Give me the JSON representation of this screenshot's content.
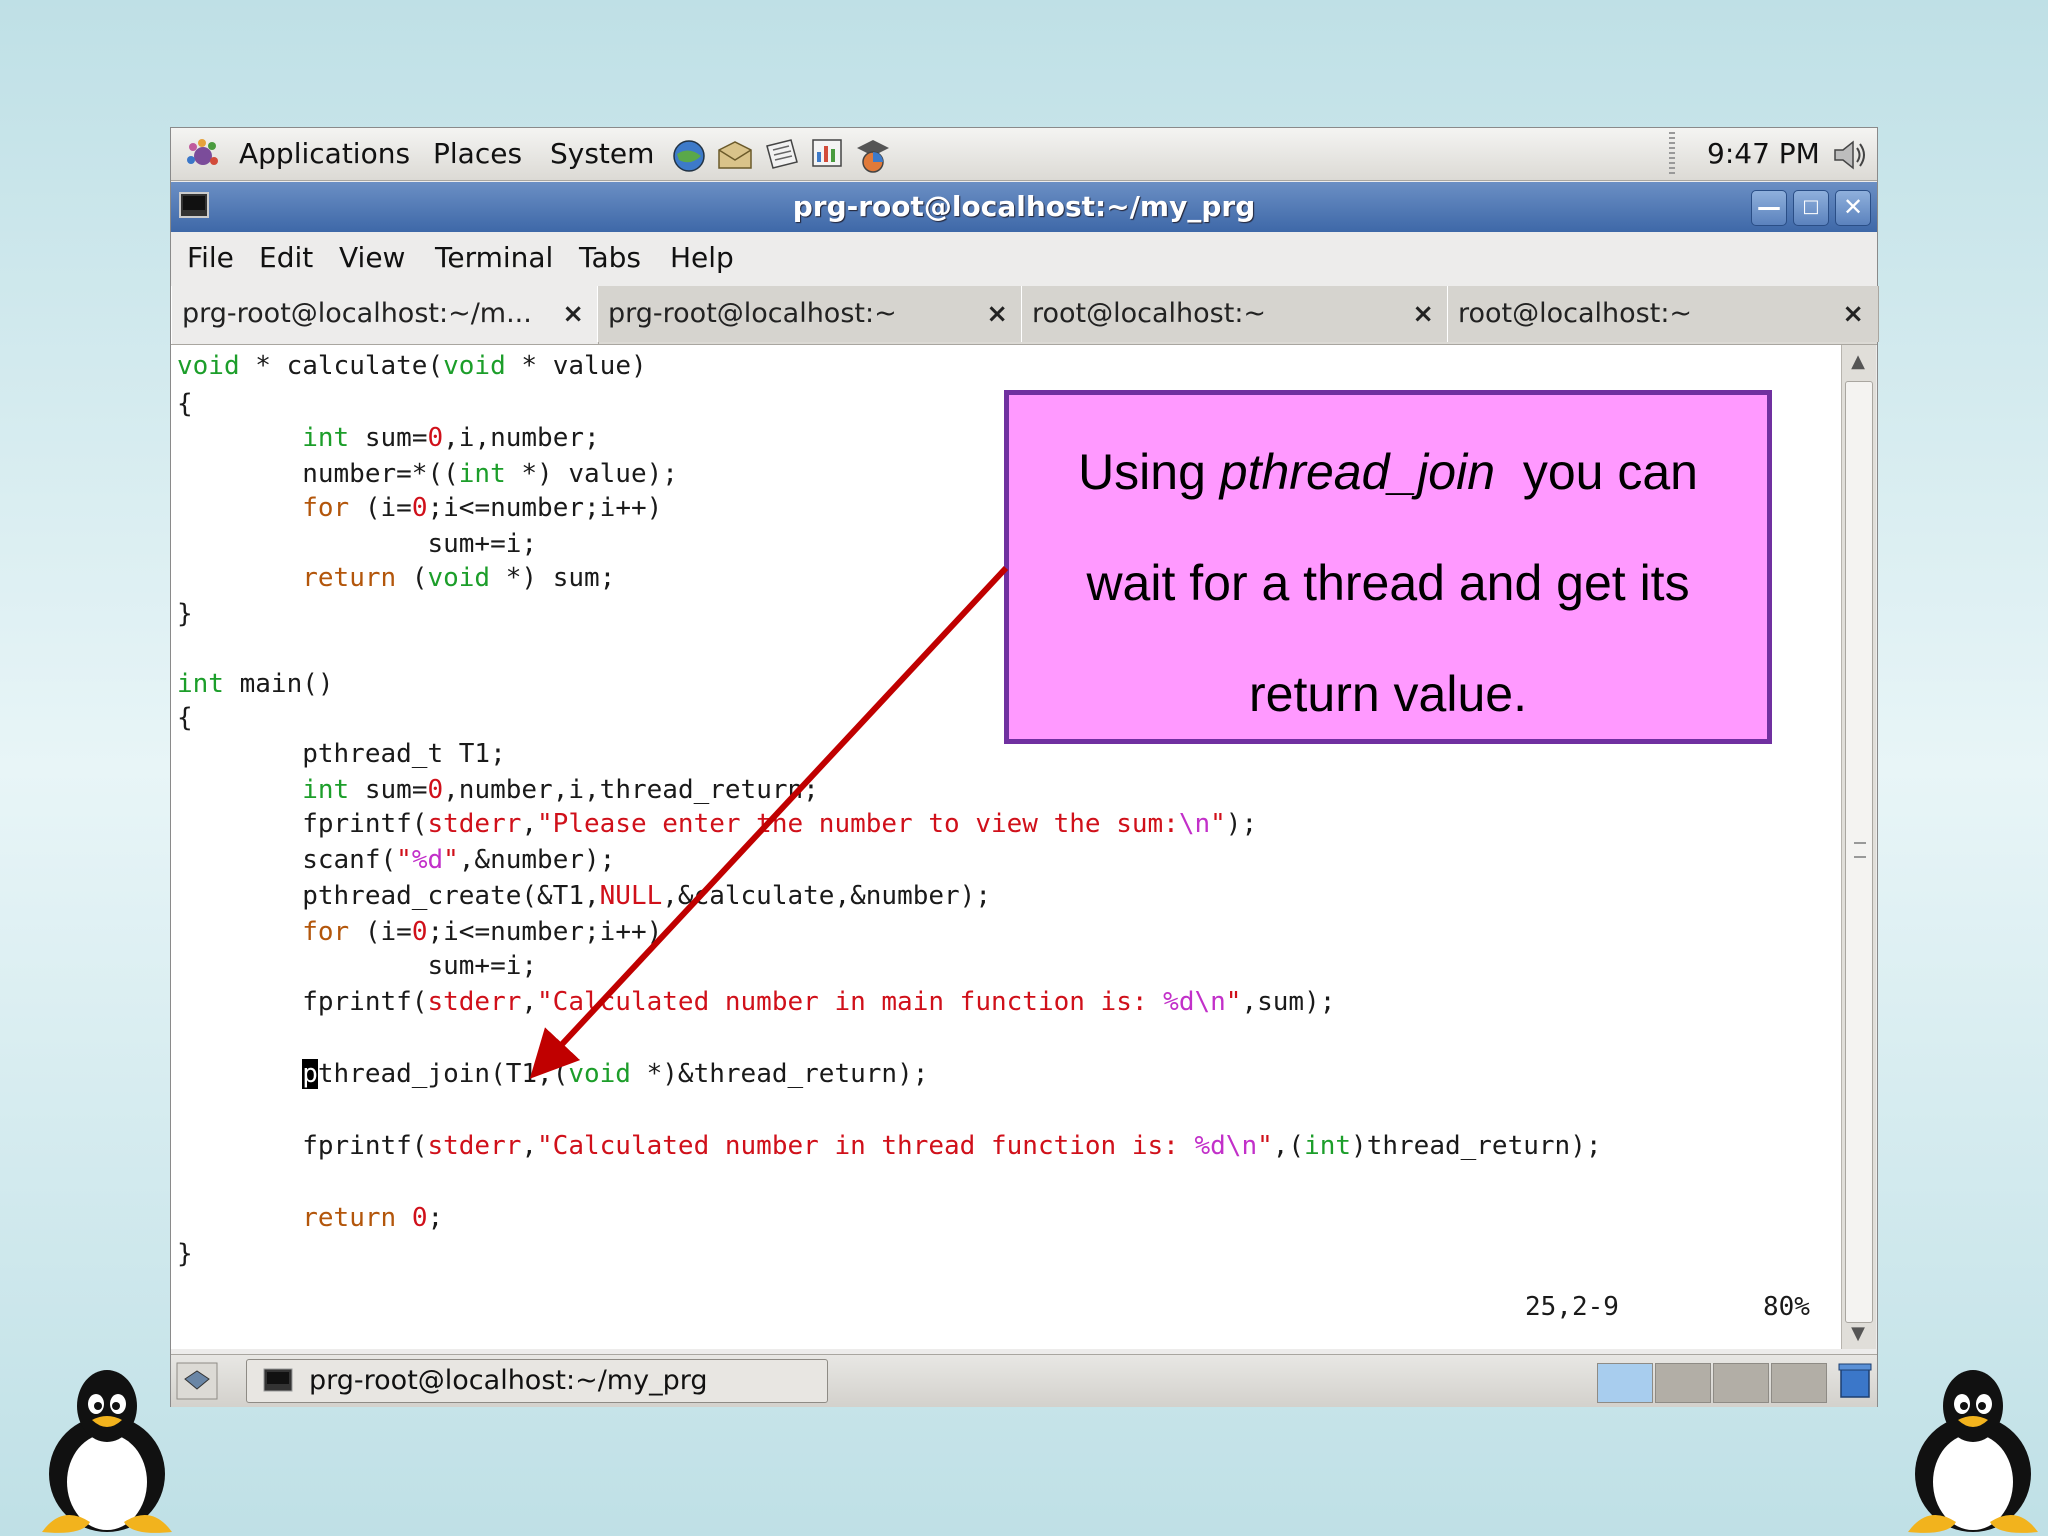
{
  "top_panel": {
    "menus": [
      "Applications",
      "Places",
      "System"
    ],
    "clock": "9:47 PM"
  },
  "window": {
    "title": "prg-root@localhost:~/my_prg"
  },
  "menubar": [
    "File",
    "Edit",
    "View",
    "Terminal",
    "Tabs",
    "Help"
  ],
  "tabs": [
    {
      "label": "prg-root@localhost:~/m...",
      "close": "×"
    },
    {
      "label": "prg-root@localhost:~",
      "close": "×"
    },
    {
      "label": "root@localhost:~",
      "close": "×"
    },
    {
      "label": "root@localhost:~",
      "close": "×"
    }
  ],
  "code": [
    "void * calculate(void * value)",
    "{",
    "        int sum=0,i,number;",
    "        number=*((int *) value);",
    "        for (i=0;i<=number;i++)",
    "                sum+=i;",
    "        return (void *) sum;",
    "}",
    "",
    "int main()",
    "{",
    "        pthread_t T1;",
    "        int sum=0,number,i,thread_return;",
    "        fprintf(stderr,\"Please enter the number to view the sum:\\n\");",
    "        scanf(\"%d\",&number);",
    "        pthread_create(&T1,NULL,&calculate,&number);",
    "        for (i=0;i<=number;i++)",
    "                sum+=i;",
    "        fprintf(stderr,\"Calculated number in main function is: %d\\n\",sum);",
    "",
    "        pthread_join(T1,(void *)&thread_return);",
    "",
    "        fprintf(stderr,\"Calculated number in thread function is: %d\\n\",(int)thread_return);",
    "",
    "        return 0;",
    "}"
  ],
  "status": {
    "position": "25,2-9",
    "percent": "80%"
  },
  "taskbar": {
    "task_label": "prg-root@localhost:~/my_prg"
  },
  "callout": {
    "line1_prefix": "Using ",
    "line1_italic": "pthread_join",
    "line1_suffix": "  you can",
    "line2": "wait for a thread and get its",
    "line3": "return value."
  },
  "colors": {
    "type_keyword": "#1c9e2a",
    "statement_keyword": "#b3560b",
    "string": "#d0101a",
    "format_specifier": "#c230c9",
    "callout_fill": "#ff99ff",
    "callout_border": "#7030a0",
    "arrow": "#c00000"
  }
}
